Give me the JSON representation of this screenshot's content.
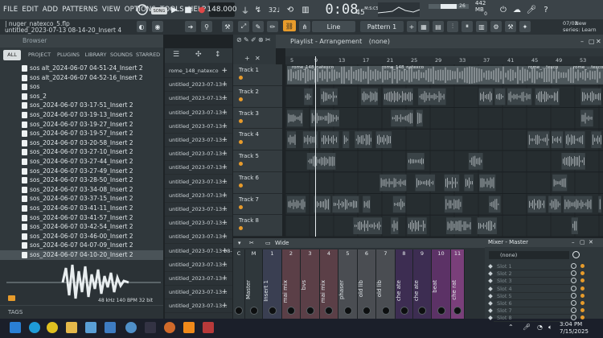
{
  "menu": [
    "FILE",
    "EDIT",
    "ADD",
    "PATTERNS",
    "VIEW",
    "OPTIONS",
    "TOOLS",
    "HELP"
  ],
  "transport": {
    "song_label": "SONG",
    "tempo": "148.000",
    "time": "0:08",
    "time_sub": "45",
    "time_unit": "M:S:CS",
    "pattern": "Pattern 1",
    "memory": "442 MB",
    "cpu_sub": "0",
    "meter_val": "26"
  },
  "hint": {
    "date": "07/02",
    "lines": [
      "New",
      "series: Learn"
    ]
  },
  "toolbar2": {
    "rate_label": "32♩",
    "snap": "Line",
    "user_info": "| nuger_natexco_5.flp",
    "project_title": "untitled_2023-07-13 08-14-20_Insert 4"
  },
  "browser": {
    "title": "Browser",
    "tabs": [
      "ALL",
      "PROJECT",
      "PLUGINS",
      "LIBRARY",
      "SOUNDS",
      "STARRED"
    ],
    "items": [
      "sos alt_2024-06-07 04-51-24_Insert 2",
      "sos alt_2024-06-07 04-52-16_Insert 2",
      "sos",
      "sos_2",
      "sos_2024-06-07 03-17-51_Insert 2",
      "sos_2024-06-07 03-19-13_Insert 2",
      "sos_2024-06-07 03-19-27_Insert 2",
      "sos_2024-06-07 03-19-57_Insert 2",
      "sos_2024-06-07 03-20-58_Insert 2",
      "sos_2024-06-07 03-27-10_Insert 2",
      "sos_2024-06-07 03-27-44_Insert 2",
      "sos_2024-06-07 03-27-49_Insert 2",
      "sos_2024-06-07 03-28-50_Insert 2",
      "sos_2024-06-07 03-34-08_Insert 2",
      "sos_2024-06-07 03-37-15_Insert 2",
      "sos_2024-06-07 03-41-11_Insert 2",
      "sos_2024-06-07 03-41-57_Insert 2",
      "sos_2024-06-07 03-42-54_Insert 2",
      "sos_2024-06-07 03-46-00_Insert 2",
      "sos_2024-06-07 04-07-09_Insert 2",
      "sos_2024-06-07 04-10-20_Insert 2"
    ],
    "preview_info": "48 kHz 140 BPM 32 bit",
    "tags_label": "TAGS"
  },
  "channels": [
    "rome_148_natexco",
    "untitled_2023-07-13...",
    "untitled_2023-07-13...",
    "untitled_2023-07-13...",
    "untitled_2023-07-13...",
    "untitled_2023-07-13...",
    "untitled_2023-07-13...",
    "untitled_2023-07-13...",
    "untitled_2023-07-13...",
    "untitled_2023-07-13...",
    "untitled_2023-07-13...",
    "untitled_2023-07-13...",
    "untitled_2023-07-13...",
    "untitled_2023-07-13 08-...",
    "untitled_2023-07-13...",
    "untitled_2023-07-13...",
    "untitled_2023-07-13...",
    "untitled_2023-07-13..."
  ],
  "playlist": {
    "title": "Playlist - Arrangement",
    "pattern_sel": "(none)",
    "ruler": [
      "5",
      "9",
      "13",
      "17",
      "21",
      "25",
      "29",
      "33",
      "37",
      "41",
      "45",
      "49",
      "53"
    ],
    "tracks": [
      "Track 1",
      "Track 2",
      "Track 3",
      "Track 4",
      "Track 5",
      "Track 6",
      "Track 7",
      "Track 8"
    ],
    "clip_labels": [
      "rome_148_natexco",
      "rome_148_natexco",
      "rome_...texco",
      "rome_...texco"
    ]
  },
  "mixer": {
    "mode": "Wide",
    "strips": [
      {
        "num": "C",
        "label": "",
        "color": "#2f373b"
      },
      {
        "num": "M",
        "label": "Master",
        "color": "#2f373b"
      },
      {
        "num": "1",
        "label": "Insert 1",
        "color": "#3a3f52"
      },
      {
        "num": "2",
        "label": "mai mix",
        "color": "#5b3f47"
      },
      {
        "num": "3",
        "label": "bvs",
        "color": "#5b3f47"
      },
      {
        "num": "4",
        "label": "mai mix",
        "color": "#5b3f47"
      },
      {
        "num": "5",
        "label": "phaser",
        "color": "#4a4d52"
      },
      {
        "num": "6",
        "label": "old lib",
        "color": "#4a4d52"
      },
      {
        "num": "7",
        "label": "old lib",
        "color": "#4a4d52"
      },
      {
        "num": "8",
        "label": "che ate",
        "color": "#3d2d52"
      },
      {
        "num": "9",
        "label": "che ate",
        "color": "#3d2d52"
      },
      {
        "num": "10",
        "label": "beat",
        "color": "#5c3266"
      },
      {
        "num": "11",
        "label": "che rat",
        "color": "#7a3f7a"
      }
    ]
  },
  "master": {
    "title": "Mixer - Master",
    "preset": "(none)",
    "slots": [
      "Slot 1",
      "Slot 2",
      "Slot 3",
      "Slot 4",
      "Slot 5",
      "Slot 6",
      "Slot 7",
      "Slot 8"
    ]
  },
  "taskbar": {
    "time": "3:04 PM",
    "date": "7/15/2025"
  },
  "colors": {
    "accent": "#e79b2b",
    "wave": "#b9c0c4",
    "clip": "#5a6468"
  }
}
